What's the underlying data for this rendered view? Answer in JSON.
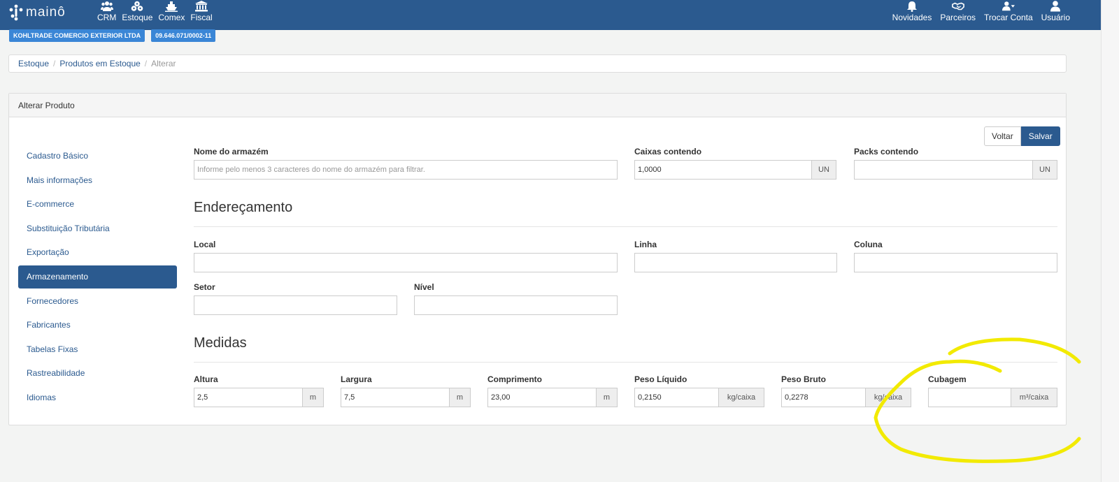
{
  "brand": {
    "name": "mainô"
  },
  "nav_left": [
    {
      "label": "CRM",
      "icon": "users-icon"
    },
    {
      "label": "Estoque",
      "icon": "boxes-icon"
    },
    {
      "label": "Comex",
      "icon": "ship-icon"
    },
    {
      "label": "Fiscal",
      "icon": "bank-icon"
    }
  ],
  "nav_right": [
    {
      "label": "Novidades",
      "icon": "bell-icon"
    },
    {
      "label": "Parceiros",
      "icon": "handshake-icon"
    },
    {
      "label": "Trocar Conta",
      "icon": "user-switch-icon"
    },
    {
      "label": "Usuário",
      "icon": "user-icon"
    }
  ],
  "company": {
    "name": "KOHLTRADE COMERCIO EXTERIOR LTDA",
    "cnpj": "09.646.071/0002-11"
  },
  "breadcrumb": [
    "Estoque",
    "Produtos em Estoque",
    "Alterar"
  ],
  "panel_title": "Alterar Produto",
  "sidenav": [
    "Cadastro Básico",
    "Mais informações",
    "E-commerce",
    "Substituição Tributária",
    "Exportação",
    "Armazenamento",
    "Fornecedores",
    "Fabricantes",
    "Tabelas Fixas",
    "Rastreabilidade",
    "Idiomas"
  ],
  "sidenav_active": "Armazenamento",
  "buttons": {
    "back": "Voltar",
    "save": "Salvar"
  },
  "form": {
    "armazem": {
      "label": "Nome do armazém",
      "placeholder": "Informe pelo menos 3 caracteres do nome do armazém para filtrar."
    },
    "caixas": {
      "label": "Caixas contendo",
      "value": "1,0000",
      "unit": "UN"
    },
    "packs": {
      "label": "Packs contendo",
      "value": "",
      "unit": "UN"
    },
    "enderecamento_title": "Endereçamento",
    "local": {
      "label": "Local",
      "value": ""
    },
    "linha": {
      "label": "Linha",
      "value": ""
    },
    "coluna": {
      "label": "Coluna",
      "value": ""
    },
    "setor": {
      "label": "Setor",
      "value": ""
    },
    "nivel": {
      "label": "Nível",
      "value": ""
    },
    "medidas_title": "Medidas",
    "altura": {
      "label": "Altura",
      "value": "2,5",
      "unit": "m"
    },
    "largura": {
      "label": "Largura",
      "value": "7,5",
      "unit": "m"
    },
    "comprimento": {
      "label": "Comprimento",
      "value": "23,00",
      "unit": "m"
    },
    "peso_liquido": {
      "label": "Peso Líquido",
      "value": "0,2150",
      "unit": "kg/caixa"
    },
    "peso_bruto": {
      "label": "Peso Bruto",
      "value": "0,2278",
      "unit": "kg/caixa"
    },
    "cubagem": {
      "label": "Cubagem",
      "value": "",
      "unit": "m³/caixa"
    }
  },
  "colors": {
    "navbar": "#2b5a8f",
    "badge": "#3a86d6",
    "annotation": "#f2ea00"
  }
}
